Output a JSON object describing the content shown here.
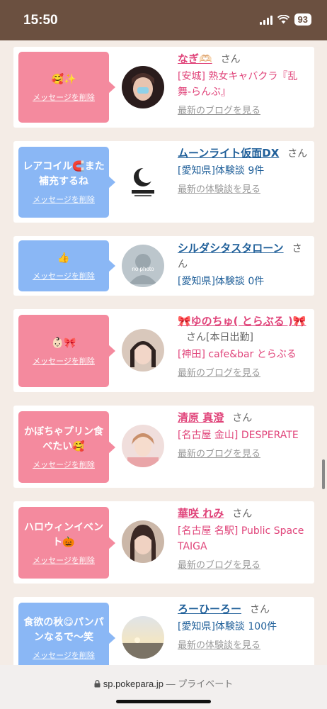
{
  "status": {
    "time": "15:50",
    "battery": "93"
  },
  "browser": {
    "url": "sp.pokepara.jp",
    "mode": "— プライベート"
  },
  "common": {
    "san": "さん",
    "delete": "メッセージを削除",
    "blog_link": "最新のブログを見る",
    "review_link": "最新の体験談を見る"
  },
  "cards": [
    {
      "message": "🥰✨",
      "name": "なぎ🫶🏻",
      "location": "[安城] 熟女キャバクラ『乱舞-らんぶ』",
      "link": "最新のブログを見る"
    },
    {
      "message": "レアコイル🧲また補充するね",
      "name": "ムーンライト仮面DX",
      "location": "[愛知県]体験談 9件",
      "link": "最新の体験談を見る"
    },
    {
      "message": "👍",
      "name": "シルダシタスタローン",
      "location": "[愛知県]体験談 0件",
      "avatar_text": "no photo"
    },
    {
      "message": "👶🏻🎀",
      "name": "🎀ゆのちゅ( とらぶる )🎀",
      "tag": "[本日出勤]",
      "location": "[神田] cafe&bar とらぶる",
      "link": "最新のブログを見る"
    },
    {
      "message": "かぼちゃプリン食べたい🥰",
      "name": "清原 真澄",
      "location": "[名古屋 金山] DESPERATE",
      "link": "最新のブログを見る"
    },
    {
      "message": "ハロウィンイベント🎃",
      "name": "華咲 れみ",
      "location": "[名古屋 名駅] Public Space TAIGA",
      "link": "最新のブログを見る"
    },
    {
      "message": "食欲の秋😋パンパンなるで〜笑",
      "name": "ろーひーろー",
      "location": "[愛知県]体験談 100件",
      "link": "最新の体験談を見る"
    }
  ]
}
